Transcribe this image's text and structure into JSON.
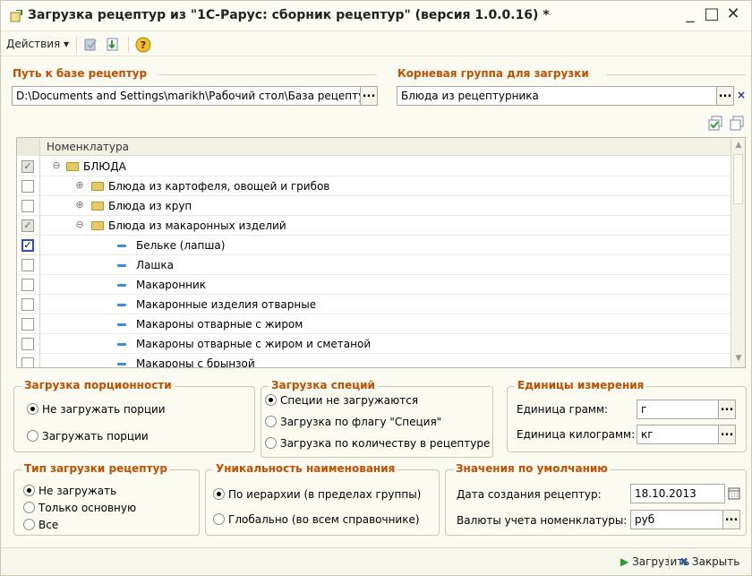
{
  "window": {
    "title": "Загрузка рецептур из \"1С-Рарус: сборник рецептур\" (версия 1.0.0.16)  *",
    "minimize": "_",
    "maximize": "□",
    "close": "✕"
  },
  "toolbar": {
    "actions_label": "Действия ▾",
    "help": "?"
  },
  "path": {
    "label": "Путь к базе рецептур",
    "value": "D:\\Documents and Settings\\marikh\\Рабочий стол\\База рецептур",
    "btn": "..."
  },
  "root_group": {
    "label": "Корневая группа для загрузки",
    "value": "Блюда из рецептурника",
    "btn": "...",
    "clear": "×"
  },
  "table": {
    "header": "Номенклатура",
    "rows": [
      {
        "text": "БЛЮДА",
        "check": "✓"
      },
      {
        "text": "Блюда из картофеля, овощей и грибов",
        "check": ""
      },
      {
        "text": "Блюда из круп",
        "check": ""
      },
      {
        "text": "Блюда из макаронных изделий",
        "check": "✓"
      },
      {
        "text": "Бельке (лапша)",
        "check": "✓"
      },
      {
        "text": "Лашка",
        "check": ""
      },
      {
        "text": "Макаронник",
        "check": ""
      },
      {
        "text": "Макаронные изделия отварные",
        "check": ""
      },
      {
        "text": "Макароны отварные с жиром",
        "check": ""
      },
      {
        "text": "Макароны отварные с жиром и сметаной",
        "check": ""
      },
      {
        "text": "Макароны с брынзой",
        "check": ""
      }
    ],
    "toggle_minus": "⊖",
    "toggle_plus": "⊕"
  },
  "portion": {
    "legend": "Загрузка порционности",
    "opt1": "Не загружать порции",
    "opt2": "Загружать порции"
  },
  "spices": {
    "legend": "Загрузка специй",
    "opt1": "Специи не загружаются",
    "opt2": "Загрузка по флагу \"Специя\"",
    "opt3": "Загрузка по количеству в рецептуре"
  },
  "units": {
    "legend": "Единицы измерения",
    "gram_label": "Единица грамм:",
    "gram_value": "г",
    "kg_label": "Единица килограмм:",
    "kg_value": "кг",
    "btn": "..."
  },
  "load_type": {
    "legend": "Тип загрузки рецептур",
    "opt1": "Не загружать",
    "opt2": "Только основную",
    "opt3": "Все"
  },
  "unique": {
    "legend": "Уникальность наименования",
    "opt1": "По иерархии (в пределах группы)",
    "opt2": "Глобально (во всем справочнике)"
  },
  "defaults": {
    "legend": "Значения по умолчанию",
    "date_label": "Дата создания рецептур:",
    "date_value": "18.10.2013",
    "currency_label": "Валюты учета номенклатуры:",
    "currency_value": "руб",
    "btn": "..."
  },
  "footer": {
    "load": "Загрузить",
    "close": "Закрыть"
  }
}
